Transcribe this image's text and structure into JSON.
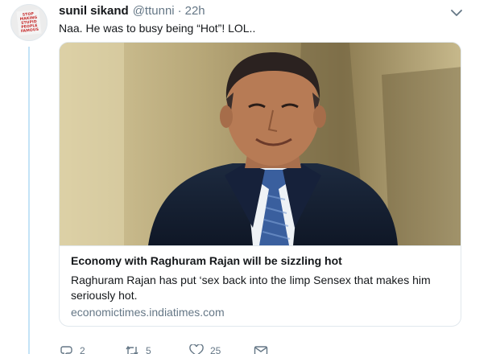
{
  "tweet": {
    "display_name": "sunil sikand",
    "handle": "@ttunni",
    "separator": "·",
    "time": "22h",
    "text": "Naa. He was to busy being “Hot”! LOL..",
    "avatar": {
      "text_lines": [
        "STOP",
        "MAKING",
        "STUPID",
        "PEOPLE",
        "FAMOUS"
      ]
    }
  },
  "card": {
    "title": "Economy with Raghuram Rajan will be sizzling hot",
    "description": "Raghuram Rajan has put ‘sex back into the limp Sensex that makes him seriously hot.",
    "domain": "economictimes.indiatimes.com"
  },
  "actions": {
    "reply_count": "2",
    "retweet_count": "5",
    "like_count": "25"
  },
  "colors": {
    "link_gray": "#657786",
    "thread_line": "#c4e3f7",
    "text": "#14171a",
    "border": "#e1e8ed"
  },
  "icons": [
    "caret-down-icon",
    "reply-icon",
    "retweet-icon",
    "like-icon",
    "direct-message-icon"
  ]
}
